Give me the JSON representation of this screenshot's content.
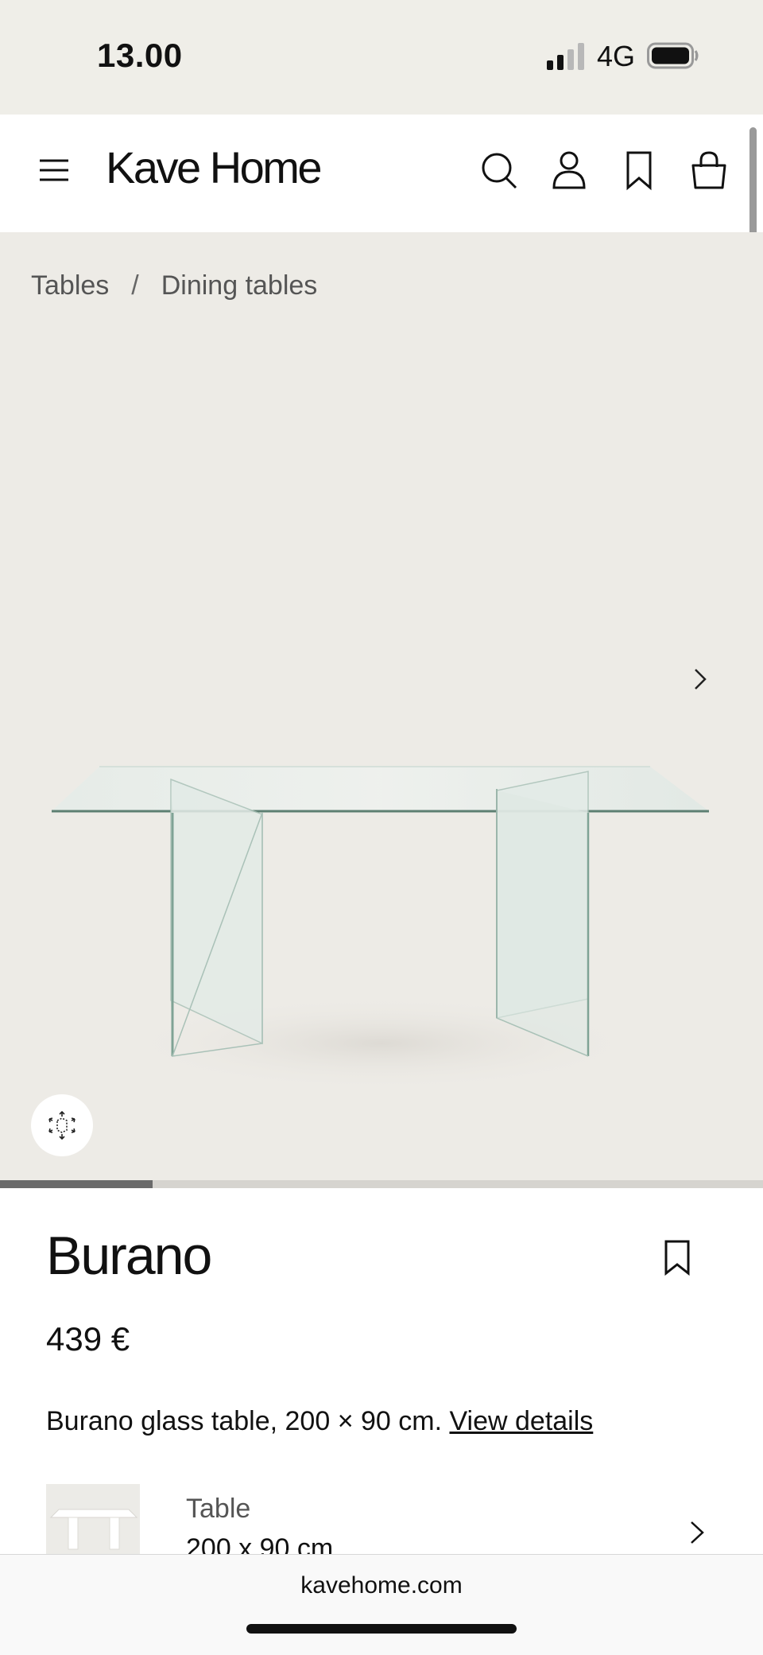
{
  "status_bar": {
    "time": "13.00",
    "network": "4G"
  },
  "header": {
    "logo": "Kave Home",
    "icons": [
      "menu-icon",
      "search-icon",
      "account-icon",
      "bookmark-icon",
      "bag-icon"
    ]
  },
  "breadcrumb": {
    "items": [
      "Tables",
      "Dining tables"
    ],
    "separator": "/"
  },
  "gallery": {
    "progress": 0.2,
    "progress_color": "#6a6a6a"
  },
  "product": {
    "name": "Burano",
    "price": "439 €",
    "description": "Burano glass table, 200 × 90 cm.",
    "details_link": "View details"
  },
  "variant": {
    "type": "Table",
    "size": "200 x 90 cm"
  },
  "browser": {
    "url": "kavehome.com"
  },
  "colors": {
    "status_bg": "#efeee8",
    "gallery_bg": "#edebe6",
    "text": "#111111"
  }
}
